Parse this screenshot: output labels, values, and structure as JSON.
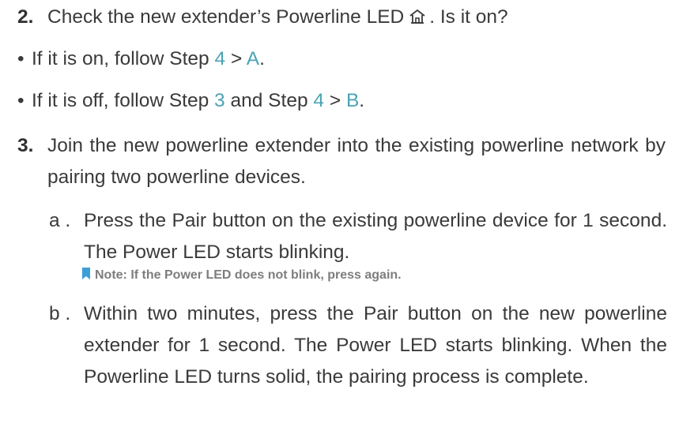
{
  "colors": {
    "text": "#3a3a3a",
    "link": "#4aa3b5",
    "note_icon": "#3b9fd8",
    "note_text": "#7d7d7d"
  },
  "step2": {
    "number": "2.",
    "text_before_icon": "Check the new extender’s Powerline LED",
    "icon": "home-icon",
    "text_after_icon": ". Is it on?"
  },
  "bullets": [
    {
      "mark": "•",
      "prefix": "If it is on, follow Step ",
      "link1": "4",
      "sep1": " > ",
      "link2": "A",
      "suffix": "."
    },
    {
      "mark": "•",
      "prefix": "If it is off, follow Step ",
      "link1": "3",
      "mid": " and Step ",
      "link2": "4",
      "sep2": " > ",
      "link3": "B",
      "suffix": "."
    }
  ],
  "step3": {
    "number": "3.",
    "text": "Join the new powerline extender into the existing powerline network by pairing two powerline devices.",
    "substeps": [
      {
        "label": "a .",
        "text": "Press the Pair button on the existing powerline device for 1 second. The Power LED starts blinking."
      },
      {
        "label": "b .",
        "text": "Within two minutes, press the Pair button on the new powerline extender for 1 second. The Power LED starts blinking. When the Powerline LED turns solid, the pairing process is complete."
      }
    ],
    "note": {
      "icon": "bookmark-icon",
      "text": "Note: If the Power LED does not blink, press again."
    }
  }
}
